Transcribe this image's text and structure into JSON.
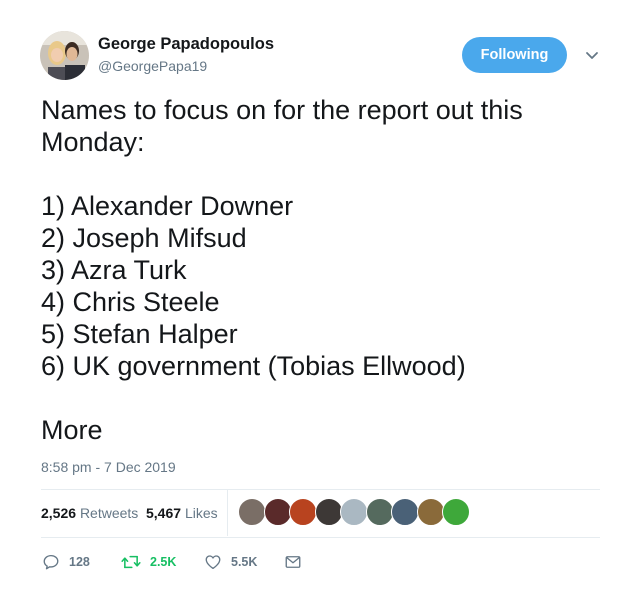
{
  "author": {
    "display_name": "George Papadopoulos",
    "handle": "@GeorgePapa19"
  },
  "follow_button": {
    "label": "Following"
  },
  "tweet": {
    "text": "Names to focus on for the report out this\nMonday:\n\n1) Alexander Downer\n2) Joseph Mifsud\n3) Azra Turk\n4) Chris Steele\n5) Stefan Halper\n6) UK government (Tobias Ellwood)",
    "more_label": "More",
    "timestamp": "8:58 pm - 7 Dec 2019"
  },
  "stats": {
    "retweets_count": "2,526",
    "retweets_label": "Retweets",
    "likes_count": "5,467",
    "likes_label": "Likes"
  },
  "liker_avatars": [
    {
      "name": "liker-avatar-1",
      "color": "#7a6e66"
    },
    {
      "name": "liker-avatar-2",
      "color": "#5a2a2a"
    },
    {
      "name": "liker-avatar-3",
      "color": "#b8431f"
    },
    {
      "name": "liker-avatar-4",
      "color": "#3d3836"
    },
    {
      "name": "liker-avatar-5",
      "color": "#aab8c2"
    },
    {
      "name": "liker-avatar-6",
      "color": "#556a5e"
    },
    {
      "name": "liker-avatar-7",
      "color": "#4a6177"
    },
    {
      "name": "liker-avatar-8",
      "color": "#8a6a3a"
    },
    {
      "name": "liker-avatar-9",
      "color": "#3ea83a"
    }
  ],
  "actions": {
    "reply_count": "128",
    "retweet_count": "2.5K",
    "like_count": "5.5K"
  },
  "colors": {
    "accent": "#4aa8ec",
    "retweet_green": "#17bf63",
    "muted": "#657786",
    "divider": "#e6ecf0"
  },
  "icons": {
    "reply": "reply-icon",
    "retweet": "retweet-icon",
    "like": "heart-icon",
    "dm": "envelope-icon",
    "caret": "chevron-down-icon"
  }
}
